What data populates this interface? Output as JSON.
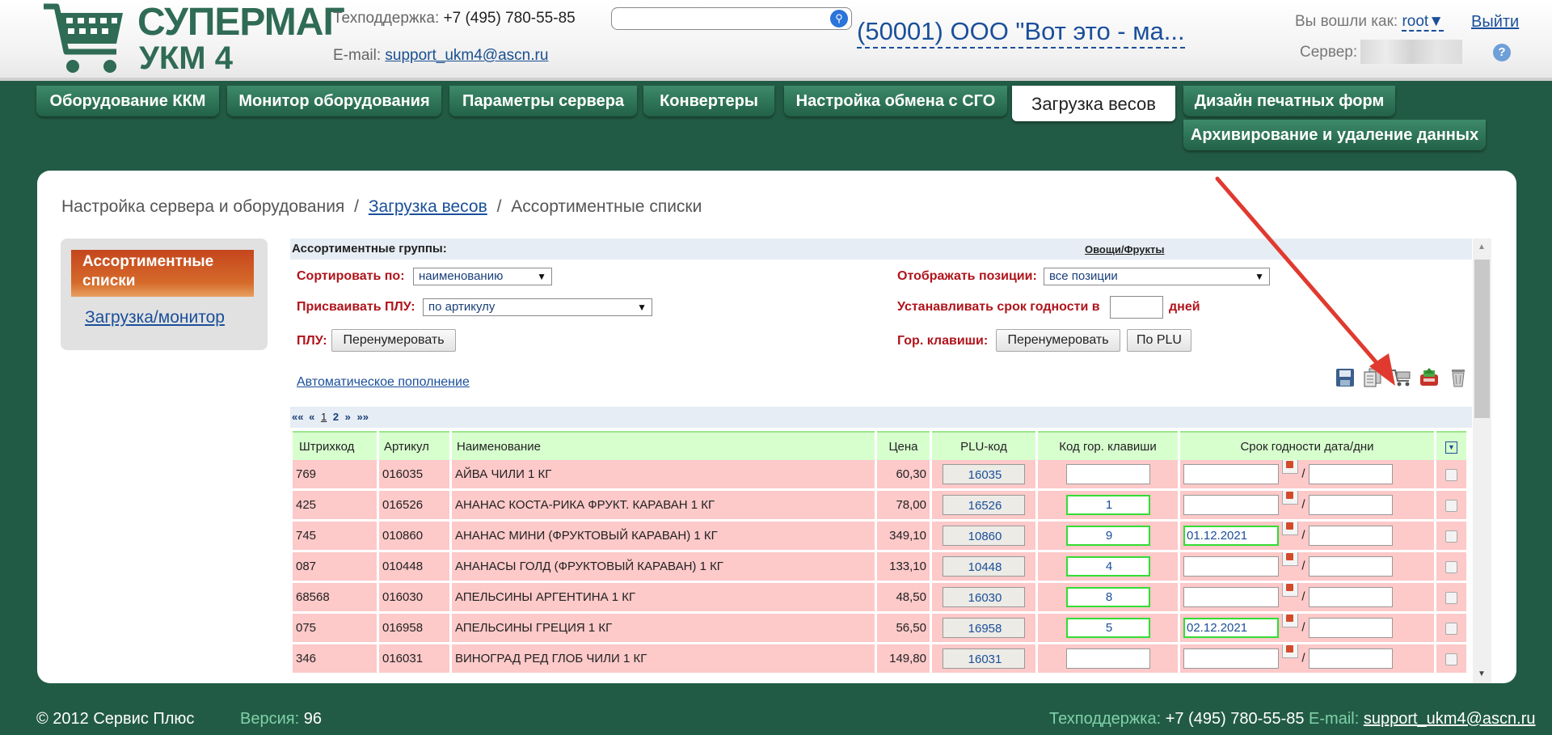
{
  "header": {
    "logo_line1": "СУПЕРМАГ",
    "logo_line2": "УКМ 4",
    "support_label": "Техподдержка:",
    "support_phone": "+7 (495) 780-55-85",
    "email_label": "E-mail:",
    "email": "support_ukm4@ascn.ru",
    "search_value": "",
    "org": "(50001) ООО \"Вот это - ма...",
    "login_label": "Вы вошли как:",
    "user": "root",
    "logout": "Выйти",
    "server_label": "Сервер:"
  },
  "tabs": [
    {
      "label": "Оборудование ККМ"
    },
    {
      "label": "Монитор оборудования"
    },
    {
      "label": "Параметры сервера"
    },
    {
      "label": "Конвертеры"
    },
    {
      "label": "Настройка обмена с СГО"
    },
    {
      "label": "Загрузка весов"
    },
    {
      "label": "Дизайн печатных форм"
    },
    {
      "label": "Архивирование и удаление данных"
    }
  ],
  "breadcrumb": {
    "root": "Настройка сервера и оборудования",
    "sep": "/",
    "link": "Загрузка весов",
    "current": "Ассортиментные списки"
  },
  "sidebar": {
    "active": "Ассортиментные списки",
    "link": "Загрузка/монитор"
  },
  "groups": {
    "title": "Ассортиментные группы:",
    "current": "Овощи/Фрукты"
  },
  "form": {
    "sort_label": "Сортировать по:",
    "sort_value": "наименованию",
    "show_label": "Отображать позиции:",
    "show_value": "все позиции",
    "assign_label": "Присваивать ПЛУ:",
    "assign_value": "по артикулу",
    "expiry_label": "Устанавливать срок годности в",
    "expiry_value": "",
    "days_label": "дней",
    "plu_label": "ПЛУ:",
    "renumber": "Перенумеровать",
    "hotkeys_label": "Гор. клавиши:",
    "by_plu": "По PLU",
    "autofill": "Автоматическое пополнение"
  },
  "toolbar_icons": [
    "save-icon",
    "copy-icon",
    "cart-icon",
    "upload-to-scales-icon",
    "trash-icon"
  ],
  "pager": {
    "first": "««",
    "prev": "«",
    "pages": [
      "1",
      "2"
    ],
    "next": "»",
    "last": "»»"
  },
  "table": {
    "columns": [
      "Штрихкод",
      "Артикул",
      "Наименование",
      "Цена",
      "PLU-код",
      "Код гор. клавиши",
      "Срок годности дата/дни"
    ],
    "rows": [
      {
        "barcode": "769",
        "article": "016035",
        "name": "АЙВА ЧИЛИ 1 КГ",
        "price": "60,30",
        "plu": "16035",
        "hotkey": "",
        "date": "",
        "days": ""
      },
      {
        "barcode": "425",
        "article": "016526",
        "name": "АНАНАС КОСТА-РИКА ФРУКТ. КАРАВАН 1 КГ",
        "price": "78,00",
        "plu": "16526",
        "hotkey": "1",
        "date": "",
        "days": ""
      },
      {
        "barcode": "745",
        "article": "010860",
        "name": "АНАНАС МИНИ (ФРУКТОВЫЙ КАРАВАН) 1 КГ",
        "price": "349,10",
        "plu": "10860",
        "hotkey": "9",
        "date": "01.12.2021",
        "days": ""
      },
      {
        "barcode": "087",
        "article": "010448",
        "name": "АНАНАСЫ ГОЛД (ФРУКТОВЫЙ КАРАВАН) 1 КГ",
        "price": "133,10",
        "plu": "10448",
        "hotkey": "4",
        "date": "",
        "days": ""
      },
      {
        "barcode": "68568",
        "article": "016030",
        "name": "АПЕЛЬСИНЫ АРГЕНТИНА 1 КГ",
        "price": "48,50",
        "plu": "16030",
        "hotkey": "8",
        "date": "",
        "days": ""
      },
      {
        "barcode": "075",
        "article": "016958",
        "name": "АПЕЛЬСИНЫ ГРЕЦИЯ 1 КГ",
        "price": "56,50",
        "plu": "16958",
        "hotkey": "5",
        "date": "02.12.2021",
        "days": ""
      },
      {
        "barcode": "346",
        "article": "016031",
        "name": "ВИНОГРАД РЕД ГЛОБ ЧИЛИ 1 КГ",
        "price": "149,80",
        "plu": "16031",
        "hotkey": "",
        "date": "",
        "days": ""
      }
    ]
  },
  "footer": {
    "copyright": "© 2012 Сервис Плюс",
    "version_label": "Версия:",
    "version": "96",
    "support_label": "Техподдержка:",
    "support_phone": "+7 (495) 780-55-85",
    "email_label": "E-mail:",
    "email": "support_ukm4@ascn.ru"
  },
  "colors": {
    "background": "#225b45",
    "tab": "#2f7457",
    "row": "#fdc9c9",
    "header_row": "#d7ffce",
    "highlight": "#33dd33",
    "arrow": "#e03a30"
  }
}
